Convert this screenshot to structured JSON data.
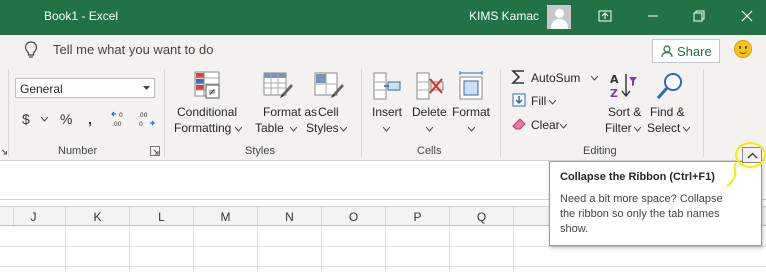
{
  "titlebar": {
    "document_title": "Book1  -  Excel",
    "user_name": "KIMS Kamac",
    "background": "#217346"
  },
  "tellme": {
    "text": "Tell me what you want to do",
    "icon": "lightbulb-icon"
  },
  "share": {
    "label": "Share",
    "icon": "person-icon"
  },
  "ribbon": {
    "number_group": {
      "label": "Number",
      "format_value": "General",
      "currency_symbol": "$",
      "percent_symbol": "%",
      "comma_symbol": ","
    },
    "styles_group": {
      "label": "Styles",
      "conditional_formatting": [
        "Conditional",
        "Formatting"
      ],
      "format_as_table": [
        "Format as",
        "Table"
      ],
      "cell_styles": [
        "Cell",
        "Styles"
      ]
    },
    "cells_group": {
      "label": "Cells",
      "insert": "Insert",
      "delete": "Delete",
      "format": "Format"
    },
    "editing_group": {
      "label": "Editing",
      "autosum": "AutoSum",
      "fill": "Fill",
      "clear": "Clear",
      "sort_filter": [
        "Sort &",
        "Filter"
      ],
      "find_select": [
        "Find &",
        "Select"
      ]
    }
  },
  "columns": [
    "J",
    "K",
    "L",
    "M",
    "N",
    "O",
    "P",
    "Q"
  ],
  "tooltip": {
    "title": "Collapse the Ribbon (Ctrl+F1)",
    "lines": [
      "Need a bit more space? Collapse",
      "the ribbon so only the tab names",
      "show."
    ]
  },
  "colors": {
    "excel_green": "#217346",
    "highlight": "#f5ee00",
    "ribbon_bg": "#f3f2f1"
  }
}
